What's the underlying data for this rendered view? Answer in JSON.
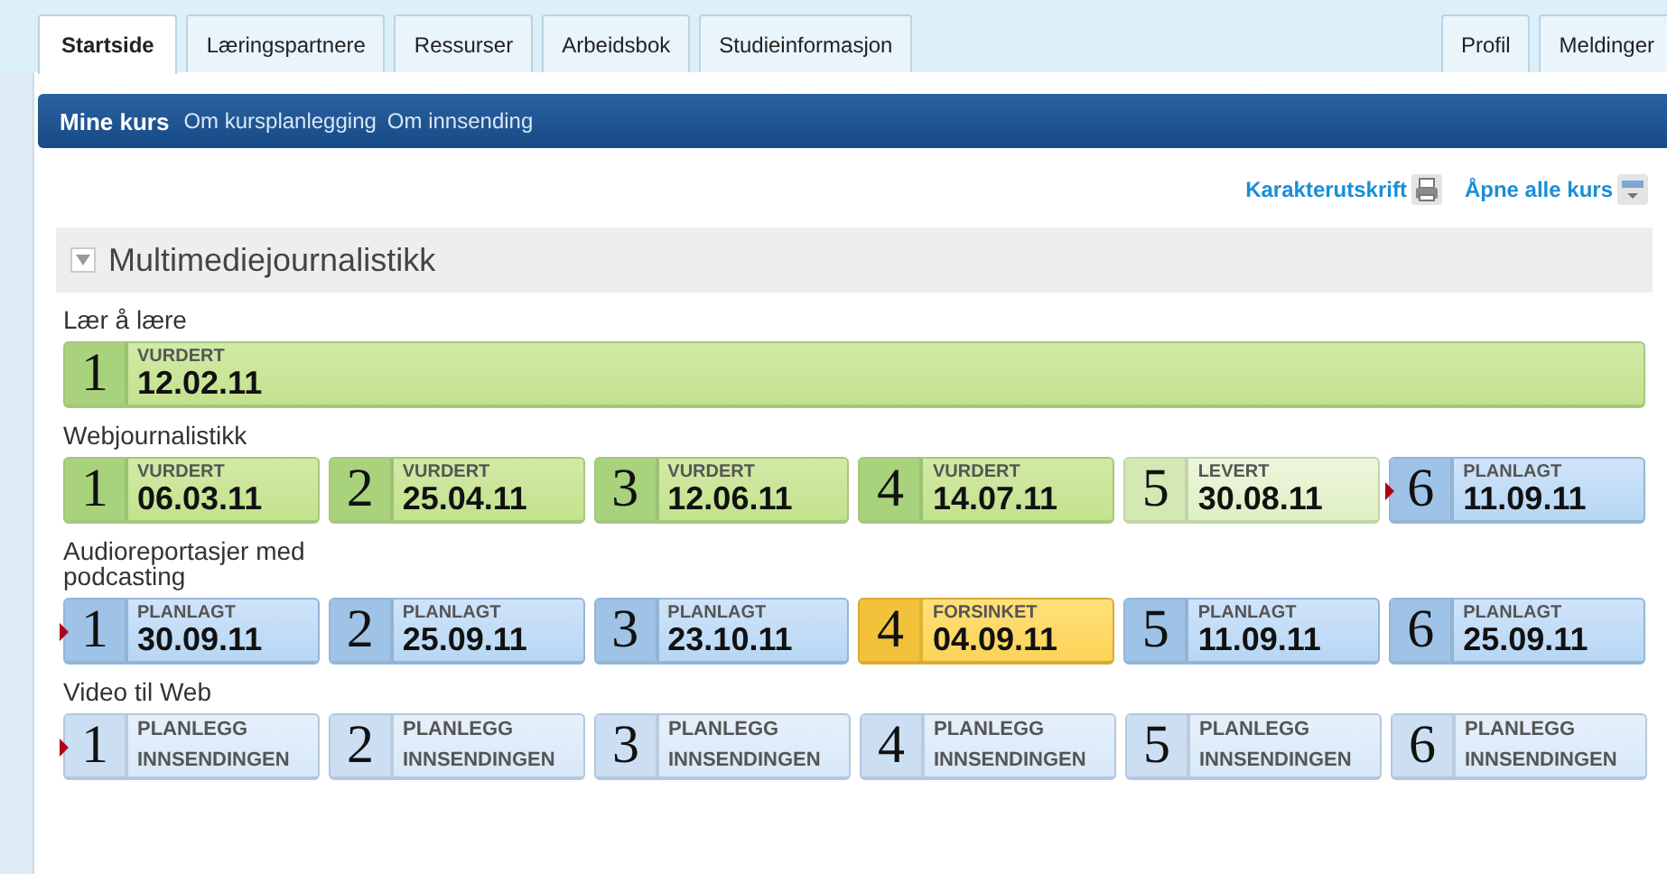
{
  "tabs": [
    {
      "label": "Startside",
      "selected": true
    },
    {
      "label": "Læringspartnere",
      "selected": false
    },
    {
      "label": "Ressurser",
      "selected": false
    },
    {
      "label": "Arbeidsbok",
      "selected": false
    },
    {
      "label": "Studieinformasjon",
      "selected": false
    }
  ],
  "right_tabs": [
    {
      "label": "Profil",
      "selected": false
    },
    {
      "label": "Meldinger",
      "selected": false
    }
  ],
  "subnav": [
    {
      "label": "Mine kurs",
      "selected": true
    },
    {
      "label": "Om kursplanlegging",
      "selected": false
    },
    {
      "label": "Om innsending",
      "selected": false
    }
  ],
  "actions": [
    {
      "label": "Karakterutskrift",
      "kind": "print"
    },
    {
      "label": "Åpne alle kurs",
      "kind": "expand"
    }
  ],
  "course": {
    "title": "Multimediejournalistikk",
    "expanded": true,
    "groups": [
      {
        "title": "Lær å lære",
        "items": [
          {
            "number": "1",
            "kind": "vurdert",
            "label": "VURDERT",
            "date": "12.02.11",
            "current": false
          }
        ]
      },
      {
        "title": "Webjournalistikk",
        "items": [
          {
            "number": "1",
            "kind": "vurdert",
            "label": "VURDERT",
            "date": "06.03.11",
            "current": false
          },
          {
            "number": "2",
            "kind": "vurdert",
            "label": "VURDERT",
            "date": "25.04.11",
            "current": false
          },
          {
            "number": "3",
            "kind": "vurdert",
            "label": "VURDERT",
            "date": "12.06.11",
            "current": false
          },
          {
            "number": "4",
            "kind": "vurdert",
            "label": "VURDERT",
            "date": "14.07.11",
            "current": false
          },
          {
            "number": "5",
            "kind": "levert",
            "label": "LEVERT",
            "date": "30.08.11",
            "current": false
          },
          {
            "number": "6",
            "kind": "planlagt",
            "label": "PLANLAGT",
            "date": "11.09.11",
            "current": true
          }
        ]
      },
      {
        "title": "Audioreportasjer med podcasting",
        "items": [
          {
            "number": "1",
            "kind": "planlagt",
            "label": "PLANLAGT",
            "date": "30.09.11",
            "current": true
          },
          {
            "number": "2",
            "kind": "planlagt",
            "label": "PLANLAGT",
            "date": "25.09.11",
            "current": false
          },
          {
            "number": "3",
            "kind": "planlagt",
            "label": "PLANLAGT",
            "date": "23.10.11",
            "current": false
          },
          {
            "number": "4",
            "kind": "forsinket",
            "label": "FORSINKET",
            "date": "04.09.11",
            "current": false
          },
          {
            "number": "5",
            "kind": "planlagt",
            "label": "PLANLAGT",
            "date": "11.09.11",
            "current": false
          },
          {
            "number": "6",
            "kind": "planlagt",
            "label": "PLANLAGT",
            "date": "25.09.11",
            "current": false
          }
        ]
      },
      {
        "title": "Video til Web",
        "items": [
          {
            "number": "1",
            "kind": "planlegg",
            "label": "PLANLEGG INNSENDINGEN",
            "current": true
          },
          {
            "number": "2",
            "kind": "planlegg",
            "label": "PLANLEGG INNSENDINGEN",
            "current": false
          },
          {
            "number": "3",
            "kind": "planlegg",
            "label": "PLANLEGG INNSENDINGEN",
            "current": false
          },
          {
            "number": "4",
            "kind": "planlegg",
            "label": "PLANLEGG INNSENDINGEN",
            "current": false
          },
          {
            "number": "5",
            "kind": "planlegg",
            "label": "PLANLEGG INNSENDINGEN",
            "current": false
          },
          {
            "number": "6",
            "kind": "planlegg",
            "label": "PLANLEGG INNSENDINGEN",
            "current": false
          }
        ]
      }
    ]
  }
}
